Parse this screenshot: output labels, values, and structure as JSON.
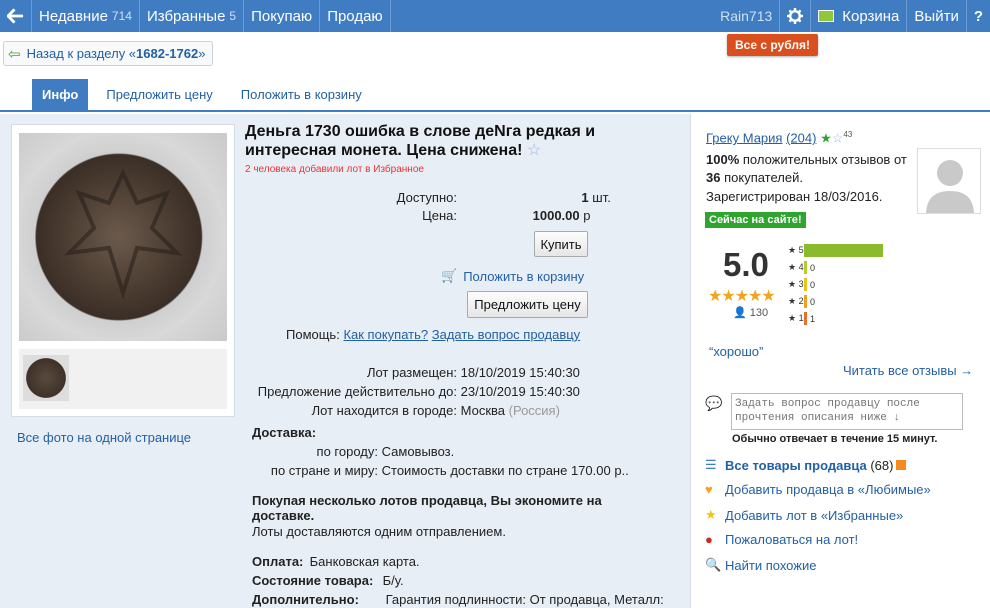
{
  "nav": {
    "recent_label": "Недавние",
    "recent_count": "714",
    "fav_label": "Избранные",
    "fav_count": "5",
    "buying": "Покупаю",
    "selling": "Продаю",
    "username": "Rain713",
    "cart": "Корзина",
    "logout": "Выйти",
    "help": "?"
  },
  "promo": "Все с рубля!",
  "back": {
    "text": "Назад к разделу «",
    "section": "1682-1762",
    "close": "»"
  },
  "tabs": [
    "Инфо",
    "Предложить цену",
    "Положить в корзину"
  ],
  "lot": {
    "title": "Деньга 1730 ошибка в слове деNга редкая и интересная монета. Цена снижена!",
    "fav_note": "2 человека добавили лот в Избранное",
    "available_label": "Доступно:",
    "available_value": "1",
    "available_unit": "шт.",
    "price_label": "Цена:",
    "price_value": "1000.00",
    "price_unit": "р",
    "buy": "Купить",
    "add_cart": "Положить в корзину",
    "offer": "Предложить цену",
    "help_label": "Помощь:",
    "help_link1": "Как покупать?",
    "help_link2": "Задать вопрос продавцу",
    "placed_label": "Лот размещен:",
    "placed_value": "18/10/2019 15:40:30",
    "valid_label": "Предложение действительно до:",
    "valid_value": "23/10/2019 15:40:30",
    "city_label": "Лот находится в городе:",
    "city_value": "Москва",
    "country": "(Россия)",
    "delivery_title": "Доставка:",
    "city_del_label": "по городу:",
    "city_del_value": "Самовывоз.",
    "country_del_label": "по стране и миру:",
    "country_del_value": "Стоимость доставки по стране 170.00 р..",
    "save_title": "Покупая несколько лотов продавца, Вы экономите на доставке.",
    "save_text": "Лоты доставляются одним отправлением.",
    "payment_label": "Оплата:",
    "payment_value": "Банковская карта.",
    "condition_label": "Состояние товара:",
    "condition_value": "Б/у.",
    "extra_label": "Дополнительно:",
    "extra_value": "Гарантия подлинности: От продавца, Металл:"
  },
  "photos": {
    "all": "Все фото на одной странице"
  },
  "seller": {
    "name": "Греку Мария",
    "rating": "(204)",
    "stars_count": "43",
    "positive_pct": "100%",
    "positive_text": "положительных отзывов",
    "from": "от",
    "buyers": "36",
    "buyers_text": "покупателей.",
    "registered": "Зарегистрирован 18/03/2016.",
    "online": "Сейчас на сайте!",
    "score": "5.0",
    "votes": "130",
    "bars": [
      {
        "star": "5",
        "count": "129",
        "color": "#8bbb2c",
        "frac": 0.99
      },
      {
        "star": "4",
        "count": "0",
        "color": "#b6cc2a",
        "frac": 0
      },
      {
        "star": "3",
        "count": "0",
        "color": "#e9c21e",
        "frac": 0
      },
      {
        "star": "2",
        "count": "0",
        "color": "#f0a020",
        "frac": 0
      },
      {
        "star": "1",
        "count": "1",
        "color": "#e8702a",
        "frac": 0.01
      }
    ],
    "review": "“хорошо”",
    "all_reviews": "Читать все отзывы →",
    "question_placeholder": "Задать вопрос продавцу после прочтения описания ниже ↓",
    "replies": "Обычно отвечает в течение 15 минут.",
    "all_goods": "Все товары продавца",
    "all_goods_count": "(68)",
    "add_fav_seller": "Добавить продавца в «Любимые»",
    "add_fav_lot": "Добавить лот в «Избранные»",
    "complain": "Пожаловаться на лот!",
    "similar": "Найти похожие"
  },
  "colors": {
    "accent": "#3f7cc2",
    "promo": "#d9501e",
    "online": "#2fa52f",
    "stars": "#f3a41c"
  }
}
